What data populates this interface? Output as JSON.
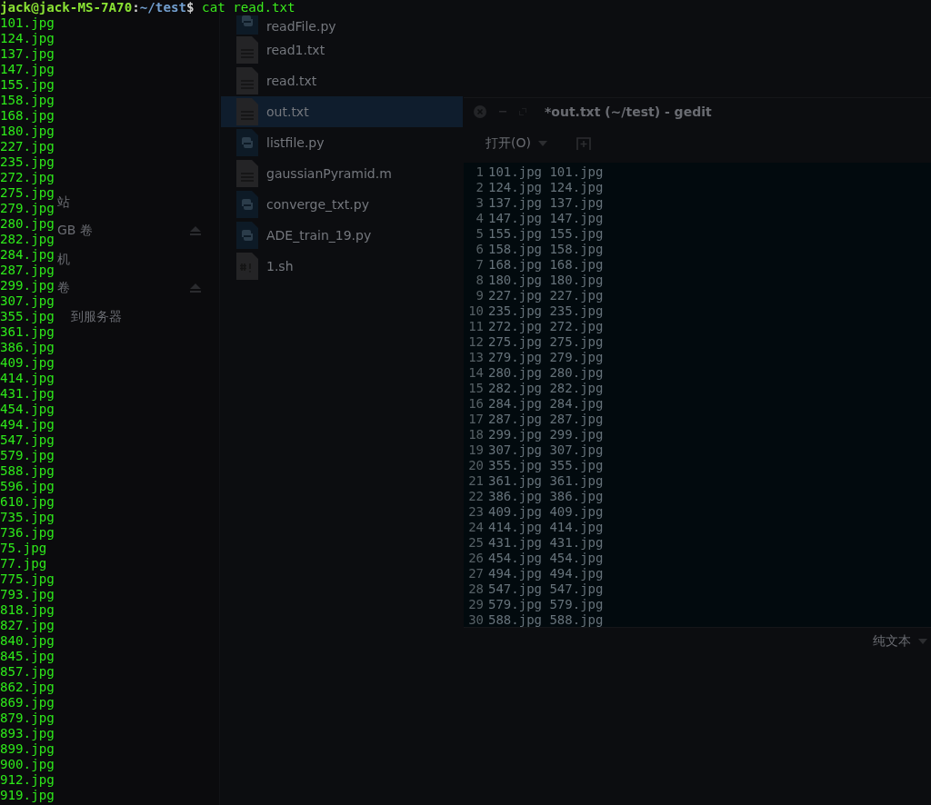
{
  "sidebar": {
    "items": [
      {
        "label": "站",
        "ejectable": false
      },
      {
        "label": "GB 卷",
        "ejectable": true
      },
      {
        "label": "机",
        "ejectable": false
      },
      {
        "label": "卷",
        "ejectable": true
      },
      {
        "label": "到服务器",
        "ejectable": false
      }
    ]
  },
  "files": [
    {
      "name": "readFile.py",
      "kind": "python",
      "selected": false
    },
    {
      "name": "read1.txt",
      "kind": "text",
      "selected": false
    },
    {
      "name": "read.txt",
      "kind": "text",
      "selected": false
    },
    {
      "name": "out.txt",
      "kind": "text",
      "selected": true
    },
    {
      "name": "listfile.py",
      "kind": "python",
      "selected": false
    },
    {
      "name": "gaussianPyramid.m",
      "kind": "text",
      "selected": false
    },
    {
      "name": "converge_txt.py",
      "kind": "python",
      "selected": false
    },
    {
      "name": "ADE_train_19.py",
      "kind": "python",
      "selected": false
    },
    {
      "name": "1.sh",
      "kind": "script",
      "selected": false
    }
  ],
  "gedit": {
    "title": "*out.txt (~/test) - gedit",
    "open_button": "打开(O)",
    "status": "纯文本",
    "lines": [
      {
        "number": "1",
        "text": "101.jpg 101.jpg"
      },
      {
        "number": "2",
        "text": "124.jpg 124.jpg"
      },
      {
        "number": "3",
        "text": "137.jpg 137.jpg"
      },
      {
        "number": "4",
        "text": "147.jpg 147.jpg"
      },
      {
        "number": "5",
        "text": "155.jpg 155.jpg"
      },
      {
        "number": "6",
        "text": "158.jpg 158.jpg"
      },
      {
        "number": "7",
        "text": "168.jpg 168.jpg"
      },
      {
        "number": "8",
        "text": "180.jpg 180.jpg"
      },
      {
        "number": "9",
        "text": "227.jpg 227.jpg"
      },
      {
        "number": "10",
        "text": "235.jpg 235.jpg"
      },
      {
        "number": "11",
        "text": "272.jpg 272.jpg"
      },
      {
        "number": "12",
        "text": "275.jpg 275.jpg"
      },
      {
        "number": "13",
        "text": "279.jpg 279.jpg"
      },
      {
        "number": "14",
        "text": "280.jpg 280.jpg"
      },
      {
        "number": "15",
        "text": "282.jpg 282.jpg"
      },
      {
        "number": "16",
        "text": "284.jpg 284.jpg"
      },
      {
        "number": "17",
        "text": "287.jpg 287.jpg"
      },
      {
        "number": "18",
        "text": "299.jpg 299.jpg"
      },
      {
        "number": "19",
        "text": "307.jpg 307.jpg"
      },
      {
        "number": "20",
        "text": "355.jpg 355.jpg"
      },
      {
        "number": "21",
        "text": "361.jpg 361.jpg"
      },
      {
        "number": "22",
        "text": "386.jpg 386.jpg"
      },
      {
        "number": "23",
        "text": "409.jpg 409.jpg"
      },
      {
        "number": "24",
        "text": "414.jpg 414.jpg"
      },
      {
        "number": "25",
        "text": "431.jpg 431.jpg"
      },
      {
        "number": "26",
        "text": "454.jpg 454.jpg"
      },
      {
        "number": "27",
        "text": "494.jpg 494.jpg"
      },
      {
        "number": "28",
        "text": "547.jpg 547.jpg"
      },
      {
        "number": "29",
        "text": "579.jpg 579.jpg"
      },
      {
        "number": "30",
        "text": "588.jpg 588.jpg"
      }
    ]
  },
  "terminal": {
    "prompt": {
      "user_host": "jack@jack-MS-7A70",
      "separator": ":",
      "path": "~/test",
      "symbol": "$",
      "command": " cat read.txt"
    },
    "output": [
      "101.jpg",
      "124.jpg",
      "137.jpg",
      "147.jpg",
      "155.jpg",
      "158.jpg",
      "168.jpg",
      "180.jpg",
      "227.jpg",
      "235.jpg",
      "272.jpg",
      "275.jpg",
      "279.jpg",
      "280.jpg",
      "282.jpg",
      "284.jpg",
      "287.jpg",
      "299.jpg",
      "307.jpg",
      "355.jpg",
      "361.jpg",
      "386.jpg",
      "409.jpg",
      "414.jpg",
      "431.jpg",
      "454.jpg",
      "494.jpg",
      "547.jpg",
      "579.jpg",
      "588.jpg",
      "596.jpg",
      "610.jpg",
      "735.jpg",
      "736.jpg",
      "75.jpg",
      "77.jpg",
      "775.jpg",
      "793.jpg",
      "818.jpg",
      "827.jpg",
      "840.jpg",
      "845.jpg",
      "857.jpg",
      "862.jpg",
      "869.jpg",
      "879.jpg",
      "893.jpg",
      "899.jpg",
      "900.jpg",
      "912.jpg",
      "919.jpg"
    ]
  }
}
